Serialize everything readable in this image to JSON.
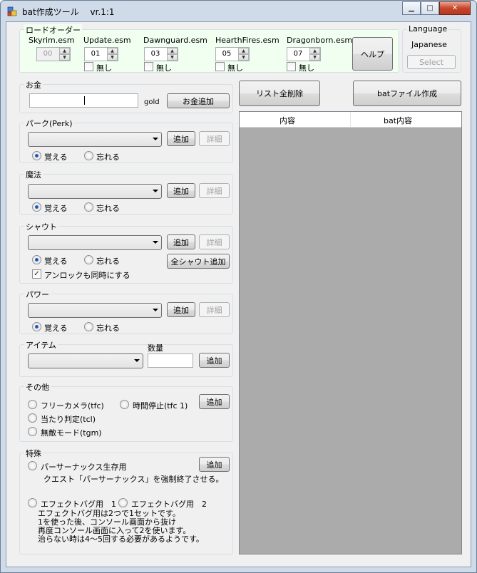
{
  "window": {
    "title": "bat作成ツール　 vr.1:1",
    "minimize_icon": "minimize-icon",
    "maximize_icon": "maximize-icon",
    "close_icon": "close-icon"
  },
  "load_order": {
    "caption": "ロードオーダー",
    "items": [
      {
        "label": "Skyrim.esm",
        "value": "00",
        "none_label": ""
      },
      {
        "label": "Update.esm",
        "value": "01",
        "none_label": "無し"
      },
      {
        "label": "Dawnguard.esm",
        "value": "03",
        "none_label": "無し"
      },
      {
        "label": "HearthFires.esm",
        "value": "05",
        "none_label": "無し"
      },
      {
        "label": "Dragonborn.esm",
        "value": "07",
        "none_label": "無し"
      }
    ],
    "help_button": "ヘルプ"
  },
  "language": {
    "caption": "Language",
    "value": "Japanese",
    "select_button": "Select"
  },
  "money": {
    "caption": "お金",
    "input_value": "",
    "unit": "gold",
    "add_button": "お金追加"
  },
  "perk": {
    "caption": "パーク(Perk)",
    "add_button": "追加",
    "detail_button": "詳細",
    "learn_label": "覚える",
    "forget_label": "忘れる"
  },
  "magic": {
    "caption": "魔法",
    "add_button": "追加",
    "detail_button": "詳細",
    "learn_label": "覚える",
    "forget_label": "忘れる"
  },
  "shout": {
    "caption": "シャウト",
    "add_button": "追加",
    "detail_button": "詳細",
    "all_add_button": "全シャウト追加",
    "learn_label": "覚える",
    "forget_label": "忘れる",
    "unlock_label": "アンロックも同時にする"
  },
  "power": {
    "caption": "パワー",
    "add_button": "追加",
    "detail_button": "詳細",
    "learn_label": "覚える",
    "forget_label": "忘れる"
  },
  "item": {
    "caption": "アイテム",
    "quantity_label": "数量",
    "quantity_value": "",
    "add_button": "追加"
  },
  "other": {
    "caption": "その他",
    "free_camera": "フリーカメラ(tfc)",
    "time_stop": "時間停止(tfc 1)",
    "collision": "当たり判定(tcl)",
    "god_mode": "無敵モード(tgm)",
    "add_button": "追加"
  },
  "special": {
    "caption": "特殊",
    "parthurnax": "パーサーナックス生存用",
    "parthurnax_note": "クエスト「パーサーナックス」を強制終了させる。",
    "add_button": "追加",
    "effect_bug1": "エフェクトバグ用　1",
    "effect_bug2": "エフェクトバグ用　2",
    "note_lines": [
      "エフェクトバグ用は2つで1セットです。",
      "1を使った後、コンソール画面から抜け",
      "再度コンソール画面に入って2を使います。",
      "治らない時は4～5回する必要があるようです。"
    ]
  },
  "actions": {
    "clear_all_button": "リスト全削除",
    "create_bat_button": "batファイル作成"
  },
  "list": {
    "col_content": "内容",
    "col_bat": "bat内容"
  }
}
